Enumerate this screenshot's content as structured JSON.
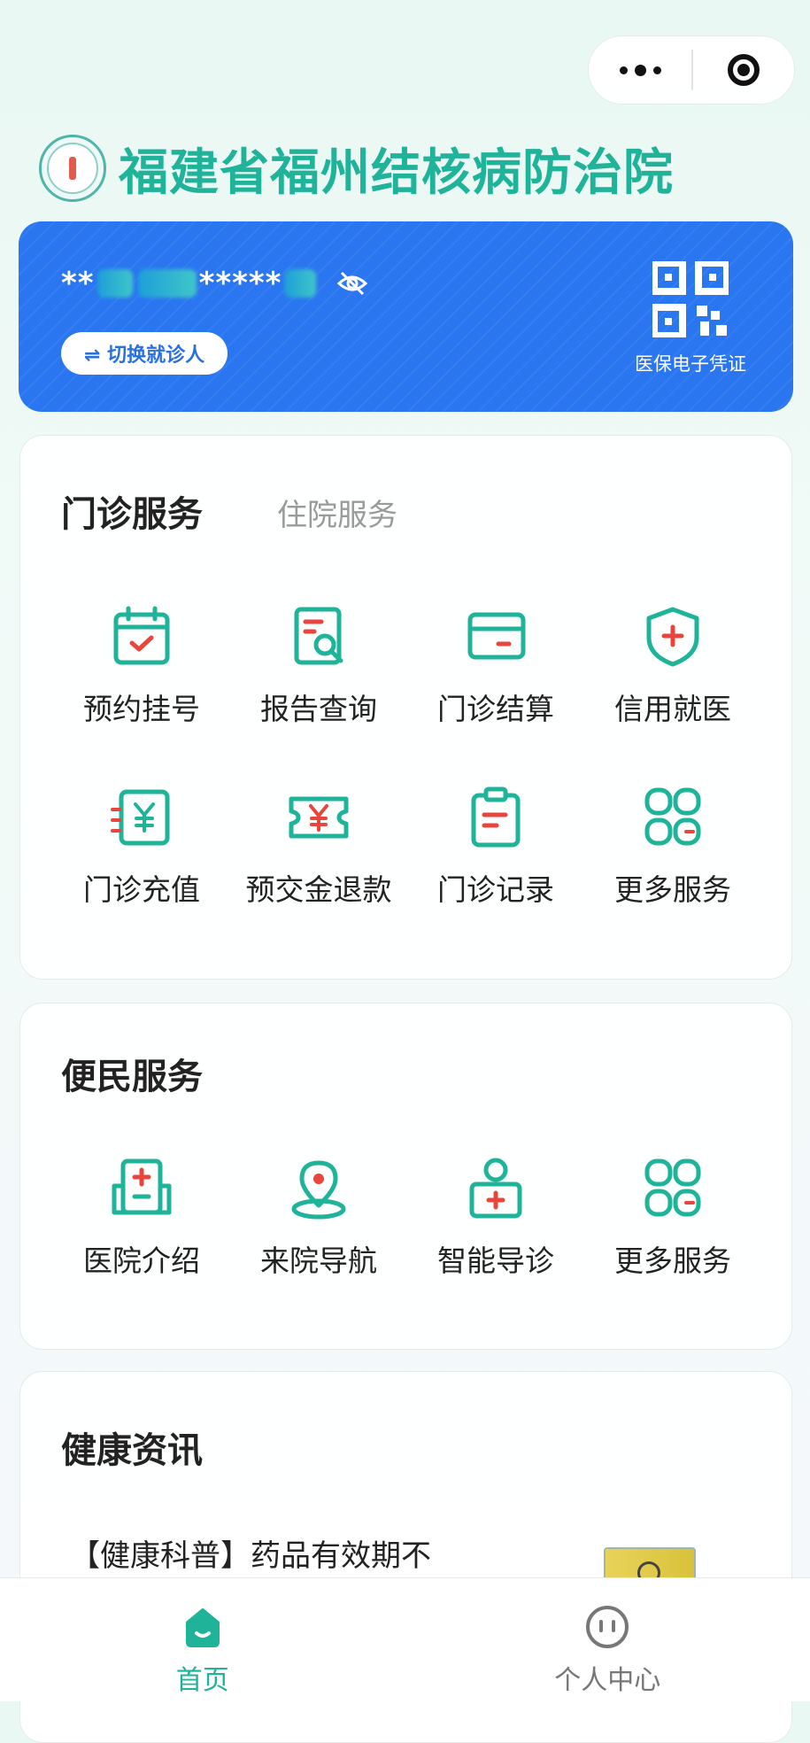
{
  "app": {
    "title": "福建省福州结核病防治院"
  },
  "capsule": {
    "more_icon": "more-dots-icon",
    "close_icon": "target-circle-icon"
  },
  "patient": {
    "name_prefix": "**",
    "name_suffix": "*****",
    "switch_label": "⇌ 切换就诊人",
    "qr_label": "医保电子凭证"
  },
  "outpatient": {
    "tab_active": "门诊服务",
    "tab_inactive": "住院服务",
    "items": [
      {
        "label": "预约挂号",
        "icon": "calendar-check-icon"
      },
      {
        "label": "报告查询",
        "icon": "report-search-icon"
      },
      {
        "label": "门诊结算",
        "icon": "card-payment-icon"
      },
      {
        "label": "信用就医",
        "icon": "shield-plus-icon"
      },
      {
        "label": "门诊充值",
        "icon": "yuan-recharge-icon"
      },
      {
        "label": "预交金退款",
        "icon": "yuan-ticket-icon"
      },
      {
        "label": "门诊记录",
        "icon": "clipboard-icon"
      },
      {
        "label": "更多服务",
        "icon": "grid-more-icon"
      }
    ]
  },
  "convenience": {
    "title": "便民服务",
    "items": [
      {
        "label": "医院介绍",
        "icon": "hospital-icon"
      },
      {
        "label": "来院导航",
        "icon": "location-pin-icon"
      },
      {
        "label": "智能导诊",
        "icon": "doctor-kit-icon"
      },
      {
        "label": "更多服务",
        "icon": "grid-more-icon"
      }
    ]
  },
  "news": {
    "title": "健康资讯",
    "items": [
      {
        "title": "【健康科普】药品有效期不"
      }
    ]
  },
  "tabbar": {
    "items": [
      {
        "label": "首页",
        "icon": "home-icon",
        "active": true
      },
      {
        "label": "个人中心",
        "icon": "profile-face-icon",
        "active": false
      }
    ]
  },
  "colors": {
    "brand_teal": "#1fb39a",
    "card_blue": "#2a76f0",
    "icon_red": "#e8453c"
  }
}
